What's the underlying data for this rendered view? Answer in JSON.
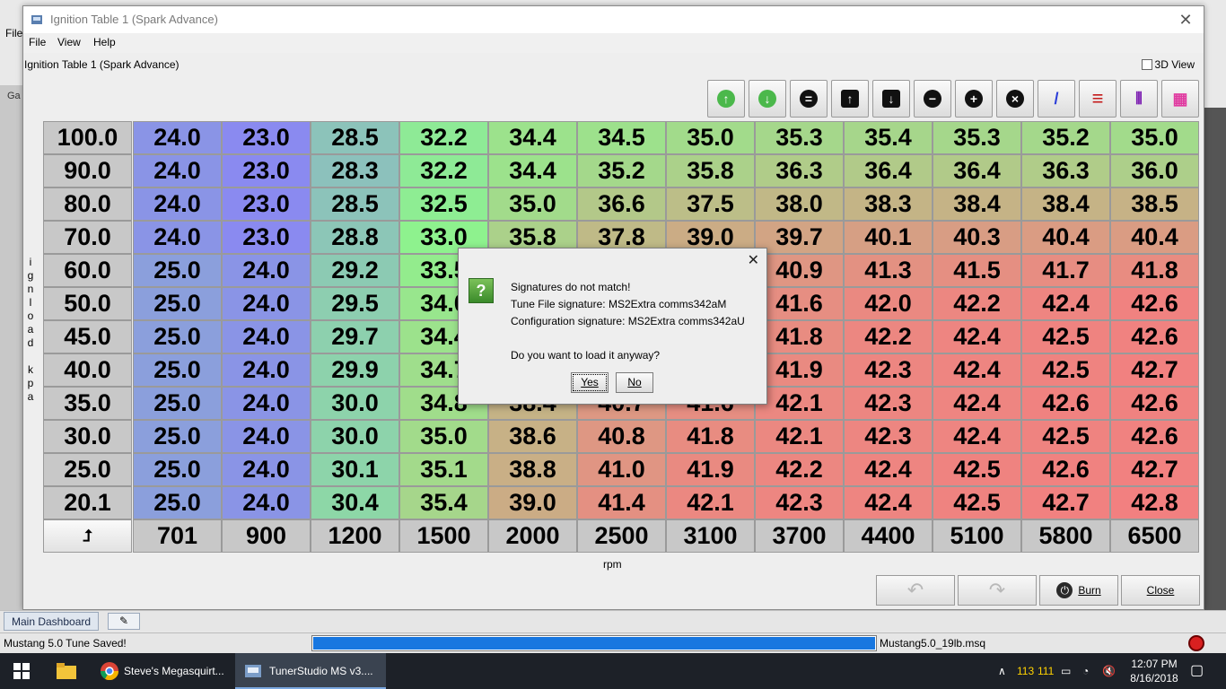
{
  "background": {
    "menu_file": "File",
    "tab_partial": "Ga"
  },
  "window": {
    "title": "Ignition Table 1 (Spark Advance)",
    "close_glyph": "✕",
    "menu": [
      "File",
      "View",
      "Help"
    ],
    "subtitle": "Ignition Table 1 (Spark Advance)",
    "view3d_label": "3D View",
    "view3d_checked": false
  },
  "toolbar": {
    "buttons": [
      {
        "icon": "increase-green-icon",
        "glyph": "↑"
      },
      {
        "icon": "decrease-green-icon",
        "glyph": "↓"
      },
      {
        "icon": "equals-icon",
        "glyph": "="
      },
      {
        "icon": "interpolate-up-icon",
        "glyph": "↑"
      },
      {
        "icon": "interpolate-down-icon",
        "glyph": "↓"
      },
      {
        "icon": "minus-icon",
        "glyph": "−"
      },
      {
        "icon": "plus-icon",
        "glyph": "+"
      },
      {
        "icon": "multiply-icon",
        "glyph": "×"
      },
      {
        "icon": "pen-icon",
        "glyph": "/"
      },
      {
        "icon": "horizontal-interpolate-icon",
        "glyph": "≡"
      },
      {
        "icon": "vertical-interpolate-icon",
        "glyph": "⦀"
      },
      {
        "icon": "smooth-icon",
        "glyph": "▦"
      }
    ]
  },
  "table": {
    "y_axis_label": [
      "i",
      "g",
      "n",
      "l",
      "o",
      "a",
      "d",
      "",
      "k",
      "p",
      "a"
    ],
    "x_axis_label": "rpm",
    "corner_glyph": "⮥",
    "rpm": [
      "701",
      "900",
      "1200",
      "1500",
      "2000",
      "2500",
      "3100",
      "3700",
      "4400",
      "5100",
      "5800",
      "6500"
    ],
    "rows": [
      {
        "load": "100.0",
        "values": [
          "24.0",
          "23.0",
          "28.5",
          "32.2",
          "34.4",
          "34.5",
          "35.0",
          "35.3",
          "35.4",
          "35.3",
          "35.2",
          "35.0"
        ]
      },
      {
        "load": "90.0",
        "values": [
          "24.0",
          "23.0",
          "28.3",
          "32.2",
          "34.4",
          "35.2",
          "35.8",
          "36.3",
          "36.4",
          "36.4",
          "36.3",
          "36.0"
        ]
      },
      {
        "load": "80.0",
        "values": [
          "24.0",
          "23.0",
          "28.5",
          "32.5",
          "35.0",
          "36.6",
          "37.5",
          "38.0",
          "38.3",
          "38.4",
          "38.4",
          "38.5"
        ]
      },
      {
        "load": "70.0",
        "values": [
          "24.0",
          "23.0",
          "28.8",
          "33.0",
          "35.8",
          "37.8",
          "39.0",
          "39.7",
          "40.1",
          "40.3",
          "40.4",
          "40.4"
        ]
      },
      {
        "load": "60.0",
        "values": [
          "25.0",
          "24.0",
          "29.2",
          "33.5",
          "",
          "",
          "",
          "40.9",
          "41.3",
          "41.5",
          "41.7",
          "41.8"
        ]
      },
      {
        "load": "50.0",
        "values": [
          "25.0",
          "24.0",
          "29.5",
          "34.0",
          "",
          "",
          "",
          "41.6",
          "42.0",
          "42.2",
          "42.4",
          "42.6"
        ]
      },
      {
        "load": "45.0",
        "values": [
          "25.0",
          "24.0",
          "29.7",
          "34.4",
          "",
          "",
          "",
          "41.8",
          "42.2",
          "42.4",
          "42.5",
          "42.6"
        ]
      },
      {
        "load": "40.0",
        "values": [
          "25.0",
          "24.0",
          "29.9",
          "34.7",
          "",
          "",
          "",
          "41.9",
          "42.3",
          "42.4",
          "42.5",
          "42.7"
        ]
      },
      {
        "load": "35.0",
        "values": [
          "25.0",
          "24.0",
          "30.0",
          "34.8",
          "38.4",
          "40.7",
          "41.6",
          "42.1",
          "42.3",
          "42.4",
          "42.6",
          "42.6"
        ]
      },
      {
        "load": "30.0",
        "values": [
          "25.0",
          "24.0",
          "30.0",
          "35.0",
          "38.6",
          "40.8",
          "41.8",
          "42.1",
          "42.3",
          "42.4",
          "42.5",
          "42.6"
        ]
      },
      {
        "load": "25.0",
        "values": [
          "25.0",
          "24.0",
          "30.1",
          "35.1",
          "38.8",
          "41.0",
          "41.9",
          "42.2",
          "42.4",
          "42.5",
          "42.6",
          "42.7"
        ]
      },
      {
        "load": "20.1",
        "values": [
          "25.0",
          "24.0",
          "30.4",
          "35.4",
          "39.0",
          "41.4",
          "42.1",
          "42.3",
          "42.4",
          "42.5",
          "42.7",
          "42.8"
        ]
      }
    ],
    "color_scale": {
      "low": "#8a8af0",
      "mid": "#8ef28e",
      "high": "#f28080"
    }
  },
  "bottom_buttons": {
    "undo_label": "",
    "redo_label": "",
    "burn_label": "Burn",
    "close_label": "Close"
  },
  "dialog": {
    "close_glyph": "✕",
    "icon_glyph": "?",
    "line1": "Signatures do not match!",
    "line2": "Tune File signature: MS2Extra comms342aM",
    "line3": "Configuration signature: MS2Extra comms342aU",
    "line4": "Do you want to load it anyway?",
    "yes_label": "Yes",
    "no_label": "No"
  },
  "dashboard": {
    "tab_label": "Main Dashboard"
  },
  "status": {
    "message": "Mustang 5.0 Tune Saved!",
    "progress": 1.0,
    "file": "Mustang5.0_19lb.msq"
  },
  "taskbar": {
    "chrome_label": "Steve's Megasquirt...",
    "tuner_label": "TunerStudio MS v3....",
    "tray_a": "113",
    "tray_b": "111",
    "time": "12:07 PM",
    "date": "8/16/2018"
  }
}
